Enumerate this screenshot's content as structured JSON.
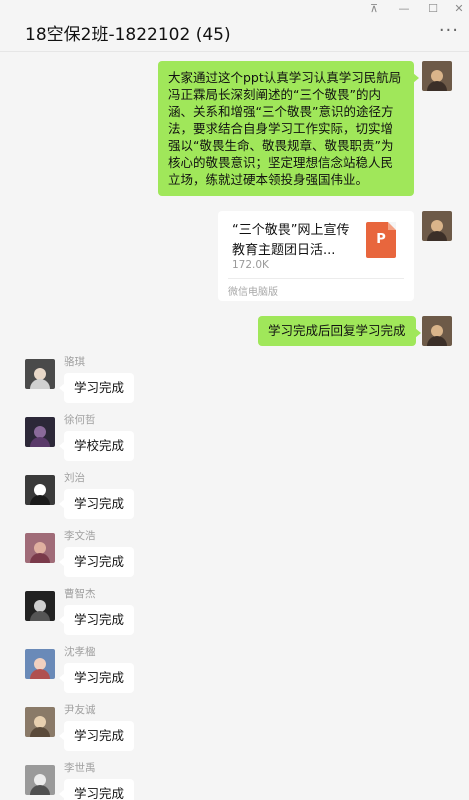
{
  "window": {
    "title": "18空保2班-1822102 (45)",
    "pin_icon": "pin-icon",
    "minimize_icon": "minimize-icon",
    "maximize_icon": "maximize-icon",
    "close_icon": "close-icon",
    "more_icon": "more-icon",
    "pin_glyph": "⊼",
    "minimize_glyph": "—",
    "maximize_glyph": "☐",
    "close_glyph": "✕",
    "more_glyph": "···"
  },
  "messages_sent": {
    "announcement": "大家通过这个ppt认真学习认真学习民航局冯正霖局长深刻阐述的“三个敬畏”的内涵、关系和增强“三个敬畏”意识的途径方法，要求结合自身学习工作实际，切实增强以“敬畏生命、敬畏规章、敬畏职责”为核心的敬畏意识；坚定理想信念站稳人民立场，练就过硬本领投身强国伟业。",
    "file": {
      "name": "“三个敬畏”网上宣传教育主题团日活...",
      "size": "172.0K",
      "source": "微信电脑版",
      "icon": "ppt-file-icon",
      "icon_letter": "P",
      "icon_color": "#e8663d"
    },
    "instruction": "学习完成后回复学习完成"
  },
  "messages_received": [
    {
      "sender": "骆琪",
      "text": "学习完成"
    },
    {
      "sender": "徐何哲",
      "text": "学校完成"
    },
    {
      "sender": "刘治",
      "text": "学习完成"
    },
    {
      "sender": "李文浩",
      "text": "学习完成"
    },
    {
      "sender": "曹智杰",
      "text": "学习完成"
    },
    {
      "sender": "沈孝楹",
      "text": "学习完成"
    },
    {
      "sender": "尹友诚",
      "text": "学习完成"
    },
    {
      "sender": "李世禹",
      "text": "学习完成"
    }
  ],
  "colors": {
    "sent_bubble": "#a0e75a",
    "received_bubble": "#ffffff",
    "background": "#f5f5f5"
  }
}
